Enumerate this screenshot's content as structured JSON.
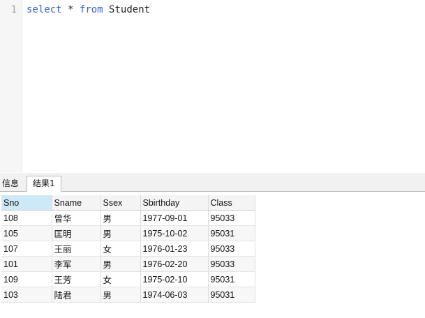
{
  "editor": {
    "line_number": "1",
    "keyword_select": "select",
    "star": "*",
    "keyword_from": "from",
    "table_name": "Student"
  },
  "tabs": [
    {
      "label": "信息"
    },
    {
      "label": "结果1"
    }
  ],
  "result": {
    "columns": [
      "Sno",
      "Sname",
      "Ssex",
      "Sbirthday",
      "Class"
    ],
    "rows": [
      [
        "108",
        "曾华",
        "男",
        "1977-09-01",
        "95033"
      ],
      [
        "105",
        "匡明",
        "男",
        "1975-10-02",
        "95031"
      ],
      [
        "107",
        "王丽",
        "女",
        "1976-01-23",
        "95033"
      ],
      [
        "101",
        "李军",
        "男",
        "1976-02-20",
        "95033"
      ],
      [
        "109",
        "王芳",
        "女",
        "1975-02-10",
        "95031"
      ],
      [
        "103",
        "陆君",
        "男",
        "1974-06-03",
        "95031"
      ]
    ]
  },
  "colors": {
    "keyword": "#3b62c9",
    "header_active": "#cde8f6"
  }
}
